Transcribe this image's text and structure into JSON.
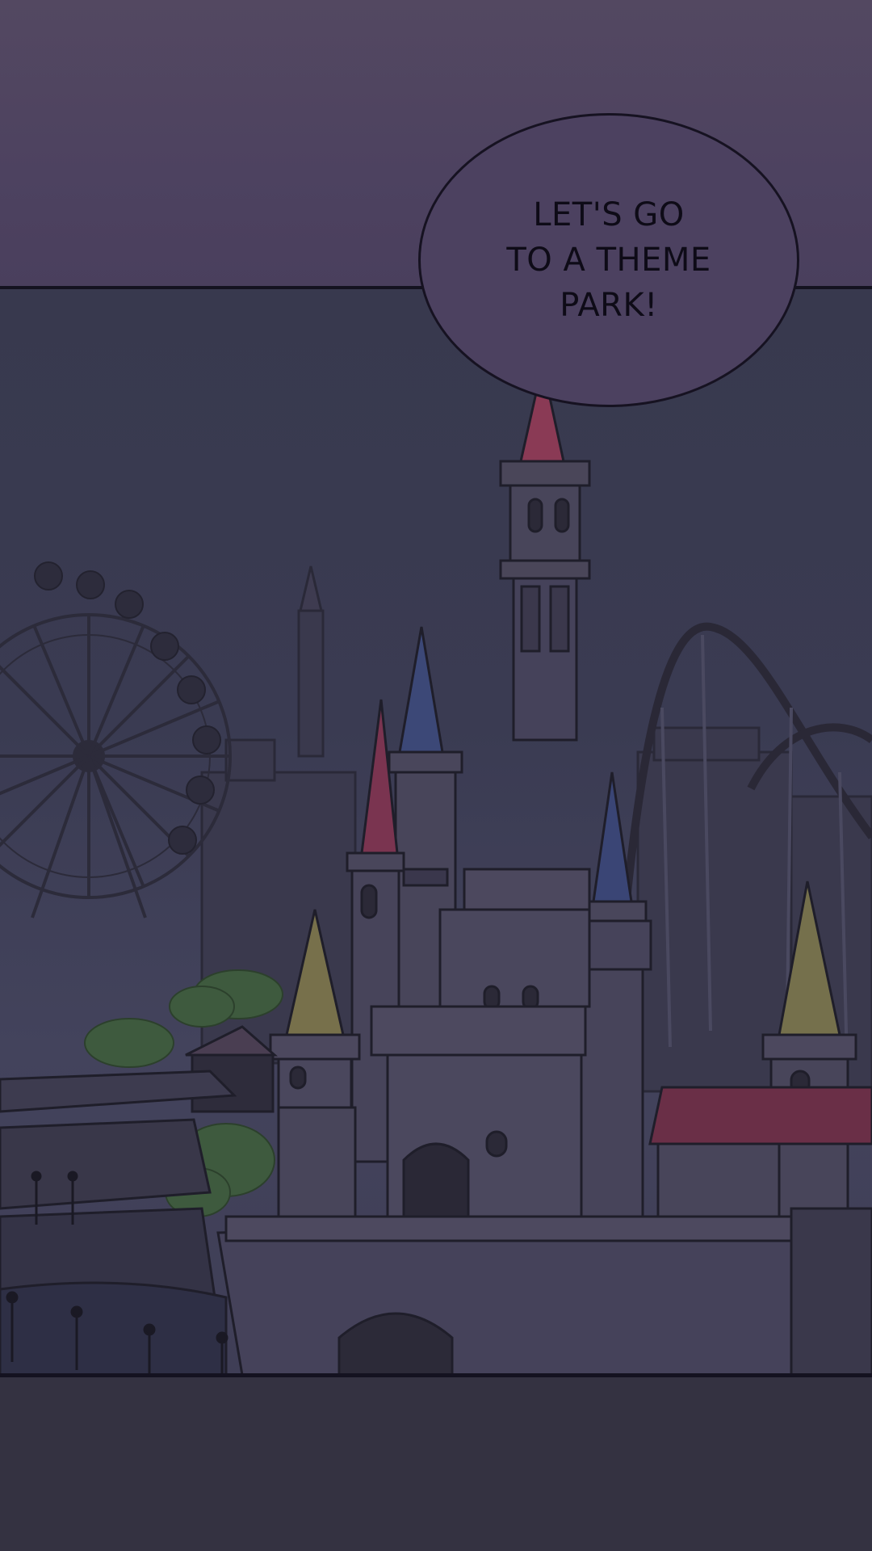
{
  "speech_bubble": {
    "text": "LET'S GO\nTO A THEME\nPARK!"
  },
  "scene": {
    "description_icons": [
      "ferris-wheel-icon",
      "castle-icon",
      "roller-coaster-icon"
    ]
  }
}
